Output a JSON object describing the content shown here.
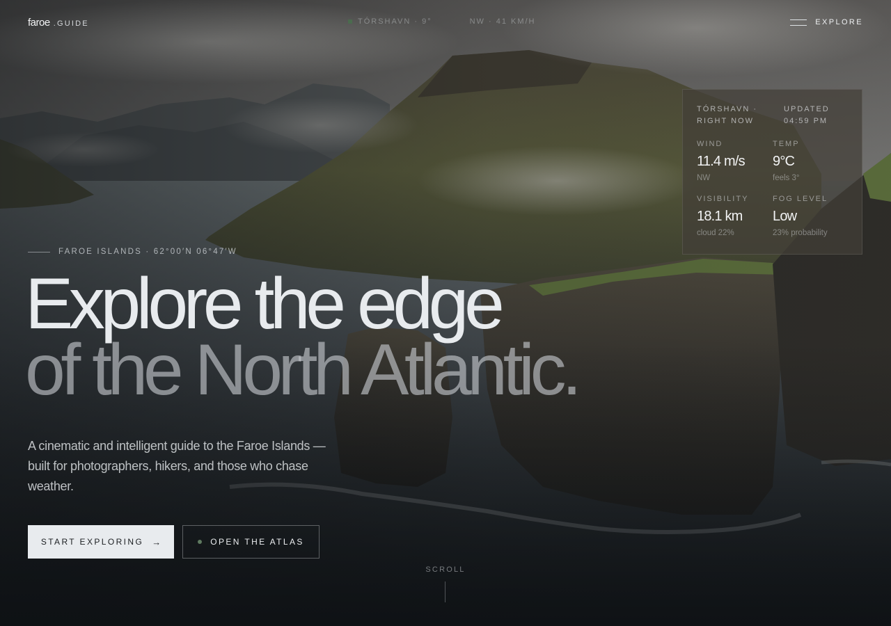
{
  "brand": {
    "name": "faroe",
    "suffix": ".GUIDE"
  },
  "ticker": {
    "location": "TÓRSHAVN · 9°",
    "wind": "NW · 41 KM/H"
  },
  "nav": {
    "menu_label": "EXPLORE"
  },
  "weather_panel": {
    "location_lines": [
      "TÓRSHAVN ·",
      "RIGHT NOW"
    ],
    "updated_lines": [
      "UPDATED",
      "04:59 PM"
    ],
    "stats": [
      {
        "label": "WIND",
        "value": "11.4 m/s",
        "sub": "NW"
      },
      {
        "label": "TEMP",
        "value": "9°C",
        "sub": "feels 3°"
      },
      {
        "label": "VISIBILITY",
        "value": "18.1 km",
        "sub": "cloud 22%"
      },
      {
        "label": "FOG LEVEL",
        "value": "Low",
        "sub": "23% probability"
      }
    ]
  },
  "hero": {
    "eyebrow": "FAROE ISLANDS · 62°00′N 06°47′W",
    "headline_line1": "Explore the edge",
    "headline_line2": "of the North Atlantic.",
    "lede": "A cinematic and intelligent guide to the Faroe Islands — built for photographers, hikers, and those who chase weather.",
    "primary_cta": "START EXPLORING",
    "primary_cta_icon": "arrow-right-icon",
    "secondary_cta": "OPEN THE ATLAS",
    "scroll_label": "SCROLL"
  },
  "colors": {
    "accent_green": "#5f7a60",
    "button_light": "#e8ebee",
    "panel_bg": "#423f38"
  }
}
